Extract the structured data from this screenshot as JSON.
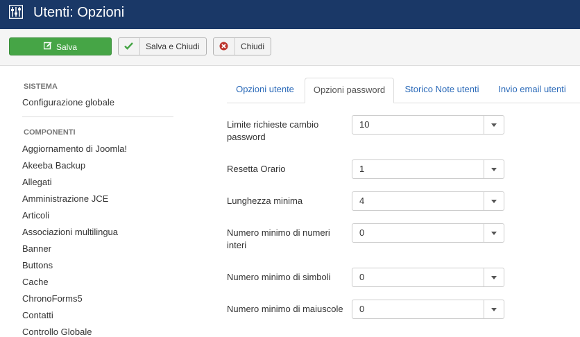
{
  "header": {
    "title": "Utenti: Opzioni",
    "bg_color": "#1a3867"
  },
  "toolbar": {
    "save_label": "Salva",
    "save_close_label": "Salva e Chiudi",
    "close_label": "Chiudi",
    "save_color": "#46a546",
    "check_color": "#46a546",
    "close_icon_color": "#bd362f"
  },
  "sidebar": {
    "system_title": "SISTEMA",
    "system_items": [
      {
        "label": "Configurazione globale"
      }
    ],
    "components_title": "COMPONENTI",
    "components_items": [
      {
        "label": "Aggiornamento di Joomla!"
      },
      {
        "label": "Akeeba Backup"
      },
      {
        "label": "Allegati"
      },
      {
        "label": "Amministrazione JCE"
      },
      {
        "label": "Articoli"
      },
      {
        "label": "Associazioni multilingua"
      },
      {
        "label": "Banner"
      },
      {
        "label": "Buttons"
      },
      {
        "label": "Cache"
      },
      {
        "label": "ChronoForms5"
      },
      {
        "label": "Contatti"
      },
      {
        "label": "Controllo Globale"
      }
    ]
  },
  "tabs": [
    {
      "label": "Opzioni utente",
      "active": false
    },
    {
      "label": "Opzioni password",
      "active": true
    },
    {
      "label": "Storico Note utenti",
      "active": false
    },
    {
      "label": "Invio email utenti",
      "active": false
    }
  ],
  "form": {
    "fields": [
      {
        "label": "Limite richieste cambio password",
        "value": "10"
      },
      {
        "label": "Resetta Orario",
        "value": "1"
      },
      {
        "label": "Lunghezza minima",
        "value": "4"
      },
      {
        "label": "Numero minimo di numeri interi",
        "value": "0"
      },
      {
        "label": "Numero minimo di simboli",
        "value": "0"
      },
      {
        "label": "Numero minimo di maiuscole",
        "value": "0"
      }
    ]
  }
}
